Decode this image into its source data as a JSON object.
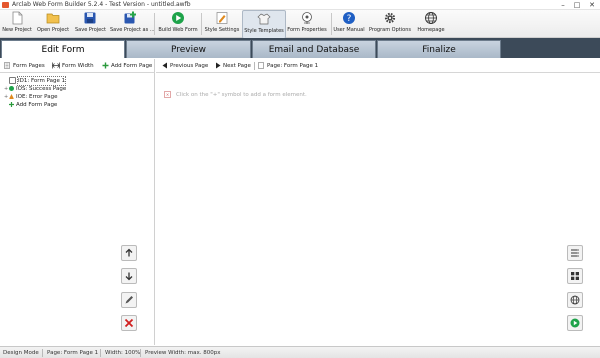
{
  "app": {
    "title": "Arclab Web Form Builder 5.2.4 - Test Version - untitled.awfb"
  },
  "toolbar": {
    "new_project": "New Project",
    "open_project": "Open Project",
    "save_project": "Save Project",
    "save_project_as": "Save Project as ...",
    "build_web_form": "Build Web Form",
    "style_settings": "Style Settings",
    "style_templates": "Style Templates",
    "form_properties": "Form Properties",
    "user_manual": "User Manual",
    "program_options": "Program Options",
    "homepage": "Homepage"
  },
  "tabs": [
    {
      "label": "Edit Form"
    },
    {
      "label": "Preview"
    },
    {
      "label": "Email and Database"
    },
    {
      "label": "Finalize"
    }
  ],
  "left_toolbar": {
    "form_pages": "Form Pages",
    "form_width": "Form Width",
    "add_form_page": "Add Form Page"
  },
  "main_toolbar": {
    "previous_page": "Previous Page",
    "next_page": "Next Page",
    "page_label": "Page: Form Page 1"
  },
  "tree": [
    {
      "label": "ID1: Form Page 1",
      "expander": "",
      "icon_color": "#7a7a7a"
    },
    {
      "label": "IOS: Success Page",
      "expander": "+",
      "icon_color": "#1ea34a"
    },
    {
      "label": "IOE: Error Page",
      "expander": "+",
      "icon_color": "#e08a1e"
    },
    {
      "label": "Add Form Page",
      "expander": "",
      "icon_color": "#2a9a3c"
    }
  ],
  "main": {
    "hint": "Click on the \"+\" symbol to add a form element."
  },
  "status": {
    "mode": "Design Mode",
    "page": "Page: Form Page 1",
    "width": "Width: 100%",
    "preview_width": "Preview Width: max. 800px"
  },
  "colors": {
    "tabbar": "#3c4a59",
    "green": "#1ea34a",
    "red": "#d11f1f",
    "blue": "#1f5fc4"
  }
}
